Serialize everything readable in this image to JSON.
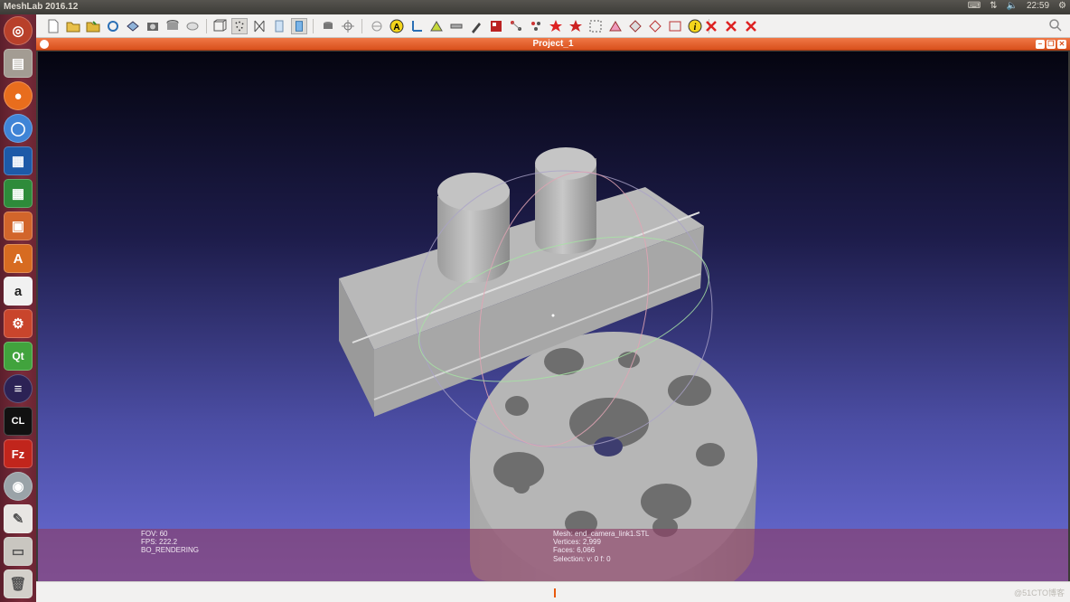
{
  "app": {
    "title": "MeshLab 2016.12"
  },
  "tray": {
    "time": "22:59"
  },
  "icons": {
    "launcher": [
      "dash-icon",
      "files-icon",
      "firefox-icon",
      "chromium-icon",
      "writer-icon",
      "calc-icon",
      "impress-icon",
      "software-center-icon",
      "amazon-icon",
      "settings-icon",
      "qtcreator-icon",
      "eclipse-icon",
      "clion-icon",
      "filezilla-icon",
      "meshlab-eye-icon",
      "text-editor-icon",
      "drive-icon",
      "trash-icon"
    ],
    "launcher_labels": {
      "amazon": "a",
      "qt": "Qt",
      "clion": "CL",
      "filezilla": "Fz"
    }
  },
  "window": {
    "title": "Project_1"
  },
  "viewport_info": {
    "left": [
      "FOV: 60",
      "FPS:   222.2",
      "BO_RENDERING"
    ],
    "right": [
      "Mesh: end_camera_link1.STL",
      "Vertices: 2,999",
      "Faces: 6,066",
      "Selection: v: 0 f: 0"
    ]
  },
  "status": {
    "watermark": "@51CTO博客"
  },
  "colors": {
    "accent": "#d9501c",
    "viewport_top": "#050510",
    "viewport_bottom": "#6a6dd6",
    "mesh": "#b8b8b8"
  }
}
